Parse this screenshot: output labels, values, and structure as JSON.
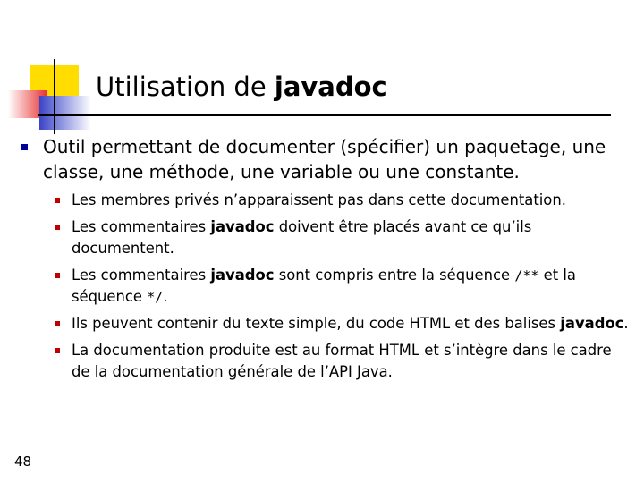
{
  "slide": {
    "title_prefix": "Utilisation de ",
    "title_keyword": "javadoc",
    "page_number": "48",
    "accent_colors": {
      "yellow": "#ffdd00",
      "red_gradient": "#e83030",
      "blue_gradient": "#3a44c8",
      "bullet_level1": "#000099",
      "bullet_level2": "#c00000"
    },
    "bullets": {
      "main": "Outil permettant de documenter (spécifier) un paquetage, une classe, une méthode, une variable ou une constante.",
      "sub1": "Les membres privés n’apparaissent pas dans cette documentation.",
      "sub2_pre": "Les commentaires ",
      "sub2_bold": "javadoc",
      "sub2_post": " doivent être placés avant ce qu’ils documentent.",
      "sub3_pre": "Les commentaires ",
      "sub3_bold": "javadoc",
      "sub3_mid": " sont compris entre la séquence ",
      "sub3_code1": "/**",
      "sub3_mid2": " et la séquence ",
      "sub3_code2": "*/",
      "sub3_end": ".",
      "sub4_pre": "Ils peuvent contenir du texte simple, du code HTML et des balises ",
      "sub4_bold": "javadoc",
      "sub4_end": ".",
      "sub5": "La documentation produite est au format HTML et s’intègre dans le cadre de la documentation générale de l’API Java."
    }
  }
}
